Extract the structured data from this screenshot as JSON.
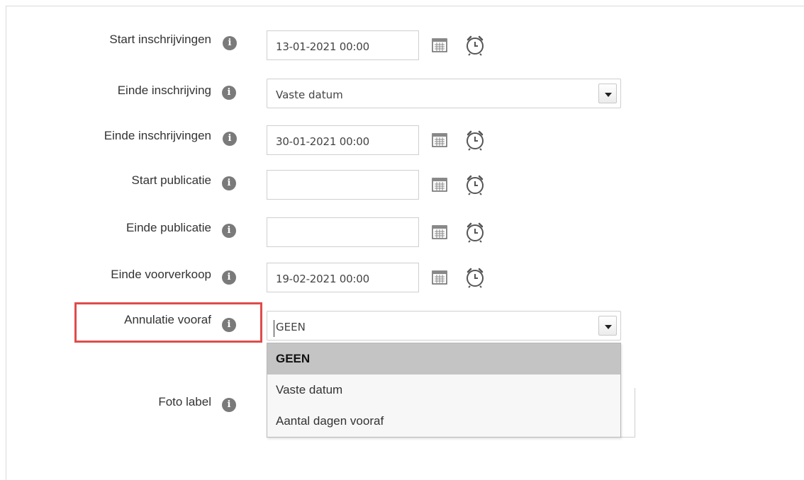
{
  "fields": [
    {
      "label": "Start inschrijvingen",
      "value": "13-01-2021 00:00"
    },
    {
      "label": "Einde inschrijving",
      "select_value": "Vaste datum"
    },
    {
      "label": "Einde inschrijvingen",
      "value": "30-01-2021 00:00"
    },
    {
      "label": "Start publicatie",
      "value": ""
    },
    {
      "label": "Einde publicatie",
      "value": ""
    },
    {
      "label": "Einde voorverkoop",
      "value": "19-02-2021 00:00"
    },
    {
      "label": "Annulatie vooraf",
      "select_value": "GEEN"
    },
    {
      "label": "Foto label"
    }
  ],
  "annulatie_dropdown": {
    "options": [
      "GEEN",
      "Vaste datum",
      "Aantal dagen vooraf"
    ],
    "selected": "GEEN"
  },
  "icons": {
    "info": "info-icon",
    "calendar": "calendar-icon",
    "clock": "clock-icon"
  },
  "colors": {
    "highlight": "#e04b4b",
    "selected_option_bg": "#c4c4c4",
    "info_icon": "#7a7a7a"
  }
}
